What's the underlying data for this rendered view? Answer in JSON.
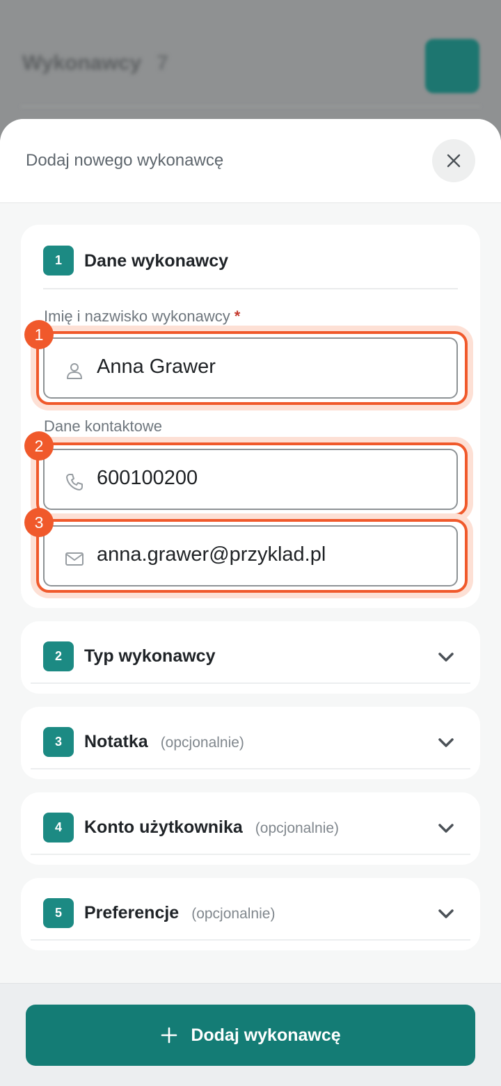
{
  "background": {
    "title": "Wykonawcy",
    "count": "7"
  },
  "sheet": {
    "title": "Dodaj nowego wykonawcę",
    "close_icon": "close-icon"
  },
  "sections": [
    {
      "step": "1",
      "title": "Dane wykonawcy",
      "fields": {
        "name_label": "Imię i nazwisko wykonawcy",
        "required_mark": "*",
        "name_value": "Anna Grawer",
        "contact_label": "Dane kontaktowe",
        "phone_value": "600100200",
        "email_value": "anna.grawer@przyklad.pl"
      },
      "markers": [
        "1",
        "2",
        "3"
      ]
    },
    {
      "step": "2",
      "title": "Typ wykonawcy",
      "optional": ""
    },
    {
      "step": "3",
      "title": "Notatka",
      "optional": "(opcjonalnie)"
    },
    {
      "step": "4",
      "title": "Konto użytkownika",
      "optional": "(opcjonalnie)"
    },
    {
      "step": "5",
      "title": "Preferencje",
      "optional": "(opcjonalnie)"
    }
  ],
  "footer": {
    "submit_label": "Dodaj wykonawcę",
    "submit_icon": "plus-icon"
  },
  "colors": {
    "accent": "#147c75",
    "badge": "#1c8a83",
    "highlight": "#f0592b"
  }
}
